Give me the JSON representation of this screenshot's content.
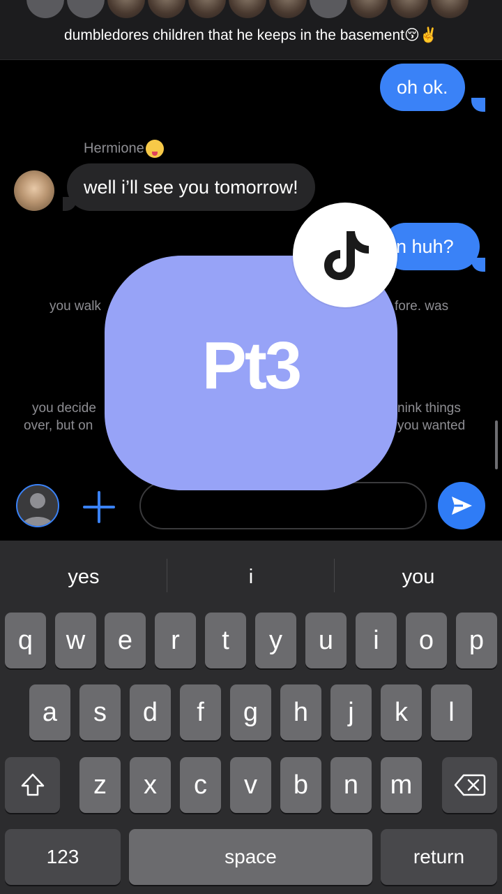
{
  "header": {
    "group_name": "dumbledores children that he keeps in the basement😚✌️"
  },
  "messages": {
    "m1": "oh ok.",
    "sender": "Hermione",
    "m2": "well i’ll see you tomorrow!",
    "m3": "n huh?"
  },
  "narration": {
    "n1_left": "you walk",
    "n1_right": "fore. was",
    "n2_left_1": "you decide",
    "n2_left_2": "over, but on",
    "n2_right_1": "nink things",
    "n2_right_2": "you wanted"
  },
  "overlay": {
    "text": "Pt3",
    "color": "#97a3f7"
  },
  "input": {
    "placeholder": ""
  },
  "keyboard": {
    "suggestions": [
      "yes",
      "i",
      "you"
    ],
    "row1": [
      "q",
      "w",
      "e",
      "r",
      "t",
      "y",
      "u",
      "i",
      "o",
      "p"
    ],
    "row2": [
      "a",
      "s",
      "d",
      "f",
      "g",
      "h",
      "j",
      "k",
      "l"
    ],
    "row3": [
      "z",
      "x",
      "c",
      "v",
      "b",
      "n",
      "m"
    ],
    "numbers_label": "123",
    "space_label": "space",
    "return_label": "return"
  },
  "colors": {
    "accent": "#3a82f7",
    "incoming_bubble": "#262628",
    "keyboard_bg": "#2c2c2e"
  }
}
